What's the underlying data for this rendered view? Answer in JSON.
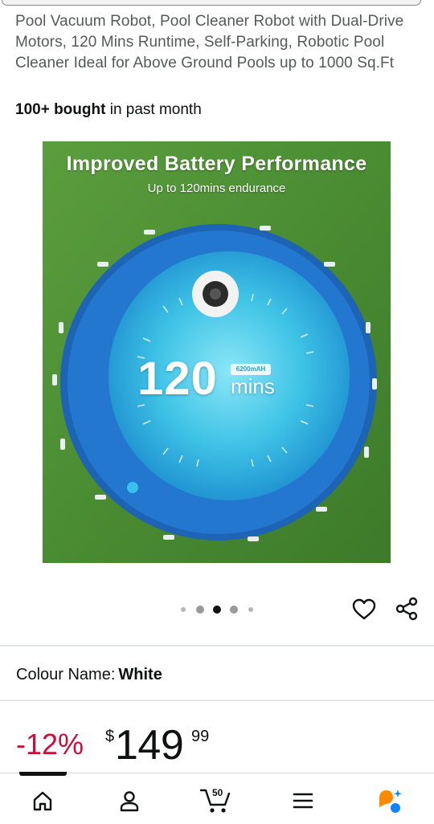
{
  "product": {
    "title": "Pool Vacuum Robot, Pool Cleaner Robot with Dual-Drive Motors, 120 Mins Runtime, Self-Parking, Robotic Pool Cleaner Ideal for Above Ground Pools up to 1000 Sq.Ft",
    "bought_bold": "100+ bought",
    "bought_rest": " in past month"
  },
  "image": {
    "headline": "Improved Battery Performance",
    "subline": "Up to 120mins endurance",
    "runtime_number": "120",
    "runtime_unit": "mins",
    "battery_badge": "6200mAH"
  },
  "carousel": {
    "total": 5,
    "active": 3
  },
  "icons": {
    "wishlist": "heart-icon",
    "share": "share-icon",
    "home": "home-icon",
    "account": "person-icon",
    "cart": "cart-icon",
    "menu": "menu-icon",
    "assistant": "assistant-icon"
  },
  "variant": {
    "label": "Colour Name:",
    "value": "White"
  },
  "price": {
    "discount": "-12%",
    "currency": "$",
    "whole": "149",
    "fraction": "99"
  },
  "cart": {
    "count": "50"
  },
  "colors": {
    "discount": "#cc0c39",
    "text": "#0f1111",
    "secondary_text": "#565959",
    "assistant_orange": "#ff8a00",
    "assistant_blue": "#0a84ff"
  }
}
